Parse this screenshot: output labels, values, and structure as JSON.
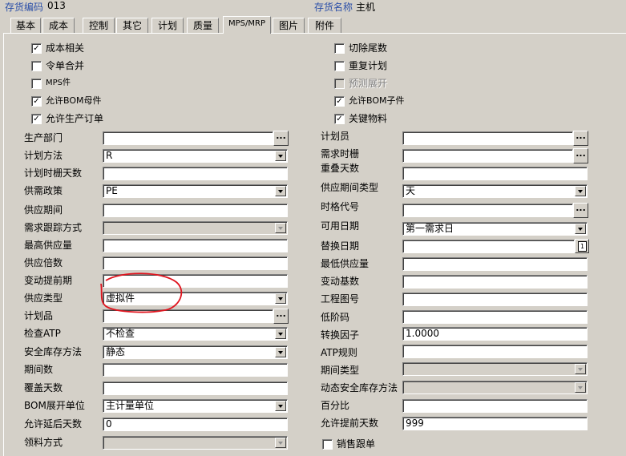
{
  "header": {
    "code_label": "存货编码",
    "code_value": "013",
    "name_label": "存货名称",
    "name_value": "主机"
  },
  "tabs": [
    {
      "label": "基本"
    },
    {
      "label": "成本"
    },
    {
      "label": "控制"
    },
    {
      "label": "其它"
    },
    {
      "label": "计划"
    },
    {
      "label": "质量"
    },
    {
      "label": "MPS/MRP"
    },
    {
      "label": "图片"
    },
    {
      "label": "附件"
    }
  ],
  "active_tab": "MPS/MRP",
  "checkboxes_left": [
    {
      "label": "成本相关",
      "checked": true
    },
    {
      "label": "令单合并",
      "checked": false
    },
    {
      "label": "MPS件",
      "checked": false
    },
    {
      "label": "允许BOM母件",
      "checked": true
    },
    {
      "label": "允许生产订单",
      "checked": true
    }
  ],
  "checkboxes_right": [
    {
      "label": "切除尾数",
      "checked": false
    },
    {
      "label": "重复计划",
      "checked": false
    },
    {
      "label": "预测展开",
      "checked": false,
      "disabled": true
    },
    {
      "label": "允许BOM子件",
      "checked": true
    },
    {
      "label": "关键物料",
      "checked": true
    }
  ],
  "left_fields": [
    {
      "label": "生产部门",
      "value": ""
    },
    {
      "label": "计划方法",
      "value": "R"
    },
    {
      "label": "计划时栅天数",
      "value": ""
    },
    {
      "label": "供需政策",
      "value": "PE"
    },
    {
      "label": "供应期间",
      "value": ""
    },
    {
      "label": "需求跟踪方式",
      "value": ""
    },
    {
      "label": "最高供应量",
      "value": ""
    },
    {
      "label": "供应倍数",
      "value": ""
    },
    {
      "label": "变动提前期",
      "value": ""
    },
    {
      "label": "供应类型",
      "value": "虚拟件"
    },
    {
      "label": "计划品",
      "value": ""
    },
    {
      "label": "检查ATP",
      "value": "不检查"
    },
    {
      "label": "安全库存方法",
      "value": "静态"
    },
    {
      "label": "期间数",
      "value": ""
    },
    {
      "label": "覆盖天数",
      "value": ""
    },
    {
      "label": "BOM展开单位",
      "value": "主计量单位"
    },
    {
      "label": "允许延后天数",
      "value": "0"
    },
    {
      "label": "领料方式",
      "value": ""
    }
  ],
  "right_fields": [
    {
      "label": "计划员",
      "value": ""
    },
    {
      "label": "需求时栅",
      "value": ""
    },
    {
      "label": "重叠天数",
      "value": ""
    },
    {
      "label": "供应期间类型",
      "value": "天"
    },
    {
      "label": "时格代号",
      "value": ""
    },
    {
      "label": "可用日期",
      "value": "第一需求日"
    },
    {
      "label": "替换日期",
      "value": ""
    },
    {
      "label": "最低供应量",
      "value": ""
    },
    {
      "label": "变动基数",
      "value": ""
    },
    {
      "label": "工程图号",
      "value": ""
    },
    {
      "label": "低阶码",
      "value": ""
    },
    {
      "label": "转换因子",
      "value": "1.0000"
    },
    {
      "label": "ATP规则",
      "value": ""
    },
    {
      "label": "期间类型",
      "value": ""
    },
    {
      "label": "动态安全库存方法",
      "value": ""
    },
    {
      "label": "百分比",
      "value": ""
    },
    {
      "label": "允许提前天数",
      "value": "999"
    }
  ],
  "bottom_checkbox": {
    "label": "销售跟单",
    "checked": false
  },
  "calendar_icon_text": "1",
  "ellipsis_text": "...",
  "annotation_color": "#e0141e"
}
